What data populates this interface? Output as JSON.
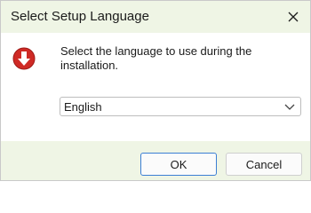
{
  "window": {
    "title": "Select Setup Language",
    "close_icon": "close-icon"
  },
  "content": {
    "icon": "setup-installer-icon",
    "message": "Select the language to use during the installation.",
    "language_select": {
      "selected": "English",
      "icon": "chevron-down-icon"
    }
  },
  "footer": {
    "ok_label": "OK",
    "cancel_label": "Cancel"
  },
  "colors": {
    "titlebar_bg": "#eff5e5",
    "footer_bg": "#eff5e5",
    "icon_red": "#cf2a25",
    "ok_border": "#3c7fd4"
  }
}
